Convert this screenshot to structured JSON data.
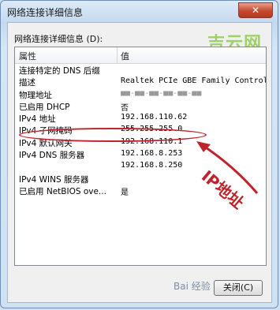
{
  "window": {
    "title": "网络连接详细信息",
    "close_glyph": "✕"
  },
  "section_label": "网络连接详细信息 (D):",
  "watermark": "吉云网",
  "columns": {
    "property": "属性",
    "value": "值"
  },
  "rows": [
    {
      "property": "连接特定的 DNS 后缀",
      "value": ""
    },
    {
      "property": "描述",
      "value": "Realtek PCIe GBE Family Controlle"
    },
    {
      "property": "物理地址",
      "value": "■■-■■-■■-■■-■■-■■"
    },
    {
      "property": "已启用 DHCP",
      "value": "否"
    },
    {
      "property": "IPv4 地址",
      "value": "192.168.110.62"
    },
    {
      "property": "IPv4 子网掩码",
      "value": "255.255.255.0"
    },
    {
      "property": "IPv4 默认网关",
      "value": "192.168.110.1"
    },
    {
      "property": "IPv4 DNS 服务器",
      "value": "192.168.8.253"
    },
    {
      "property": "",
      "value": "192.168.8.250"
    },
    {
      "property": "IPv4 WINS 服务器",
      "value": ""
    },
    {
      "property": "已启用 NetBIOS ove...",
      "value": "是"
    }
  ],
  "annotation": {
    "text": "IP地址",
    "color": "#c0232b"
  },
  "footer": {
    "baidu_watermark": "Bai 经验",
    "close_label": "关闭(C)"
  }
}
